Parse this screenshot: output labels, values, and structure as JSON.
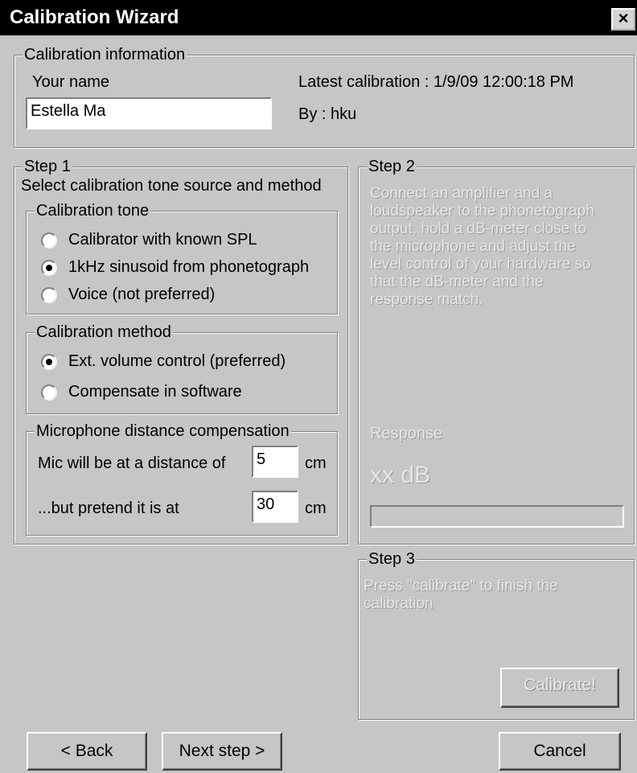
{
  "window": {
    "title": "Calibration Wizard",
    "close_glyph": "×"
  },
  "info": {
    "legend": "Calibration information",
    "name_label": "Your name",
    "name_value": "Estella Ma",
    "latest": "Latest calibration : 1/9/09 12:00:18 PM",
    "by": "By : hku"
  },
  "step1": {
    "legend": "Step 1",
    "intro": "Select calibration tone source and method",
    "tone": {
      "legend": "Calibration tone",
      "options": [
        {
          "label": "Calibrator with known SPL",
          "selected": false
        },
        {
          "label": "1kHz sinusoid from phonetograph",
          "selected": true
        },
        {
          "label": "Voice (not preferred)",
          "selected": false
        }
      ]
    },
    "method": {
      "legend": "Calibration method",
      "options": [
        {
          "label": "Ext. volume control (preferred)",
          "selected": true
        },
        {
          "label": "Compensate in software",
          "selected": false
        }
      ]
    },
    "mic": {
      "legend": "Microphone distance compensation",
      "distance_label": "Mic will be at a distance of",
      "distance_value": "5",
      "pretend_label": "...but pretend it is at",
      "pretend_value": "30",
      "unit": "cm"
    }
  },
  "step2": {
    "legend": "Step 2",
    "text_lines": [
      "Connect an amplifier and a",
      "loudspeaker to the phonetograph",
      "output, hold a dB-meter close to",
      "the microphone and adjust the",
      "level control of your hardware so",
      "that the dB-meter and the",
      "response match."
    ],
    "response_label": "Response",
    "response_value": "xx dB",
    "level_fraction": 0
  },
  "step3": {
    "legend": "Step 3",
    "text_lines": [
      "Press \"calibrate\" to finish the",
      "calibration"
    ],
    "calibrate_button": "Calibrate!"
  },
  "footer": {
    "back_button": "< Back",
    "next_button": "Next step >",
    "cancel_button": "Cancel"
  }
}
